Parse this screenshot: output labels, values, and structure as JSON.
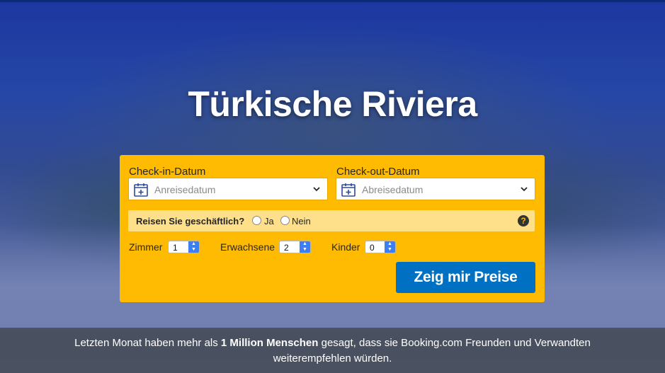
{
  "hero": {
    "title": "Türkische Riviera"
  },
  "form": {
    "checkin": {
      "label": "Check-in-Datum",
      "placeholder": "Anreisedatum"
    },
    "checkout": {
      "label": "Check-out-Datum",
      "placeholder": "Abreisedatum"
    },
    "business": {
      "question": "Reisen Sie geschäftlich?",
      "yes": "Ja",
      "no": "Nein",
      "help": "?"
    },
    "rooms": {
      "label": "Zimmer",
      "value": "1"
    },
    "adults": {
      "label": "Erwachsene",
      "value": "2"
    },
    "children": {
      "label": "Kinder",
      "value": "0"
    },
    "submit": "Zeig mir Preise"
  },
  "footer": {
    "pre": "Letzten Monat haben mehr als ",
    "bold": "1 Million Menschen",
    "post": " gesagt, dass sie Booking.com Freunden und Verwandten",
    "line2": "weiterempfehlen würden."
  },
  "colors": {
    "form_bg": "#febb02",
    "button": "#0071c2",
    "calendar_icon": "#2c4a9a"
  },
  "icons": {
    "calendar": "calendar-icon",
    "chevron": "chevron-down-icon",
    "help": "help-icon"
  }
}
